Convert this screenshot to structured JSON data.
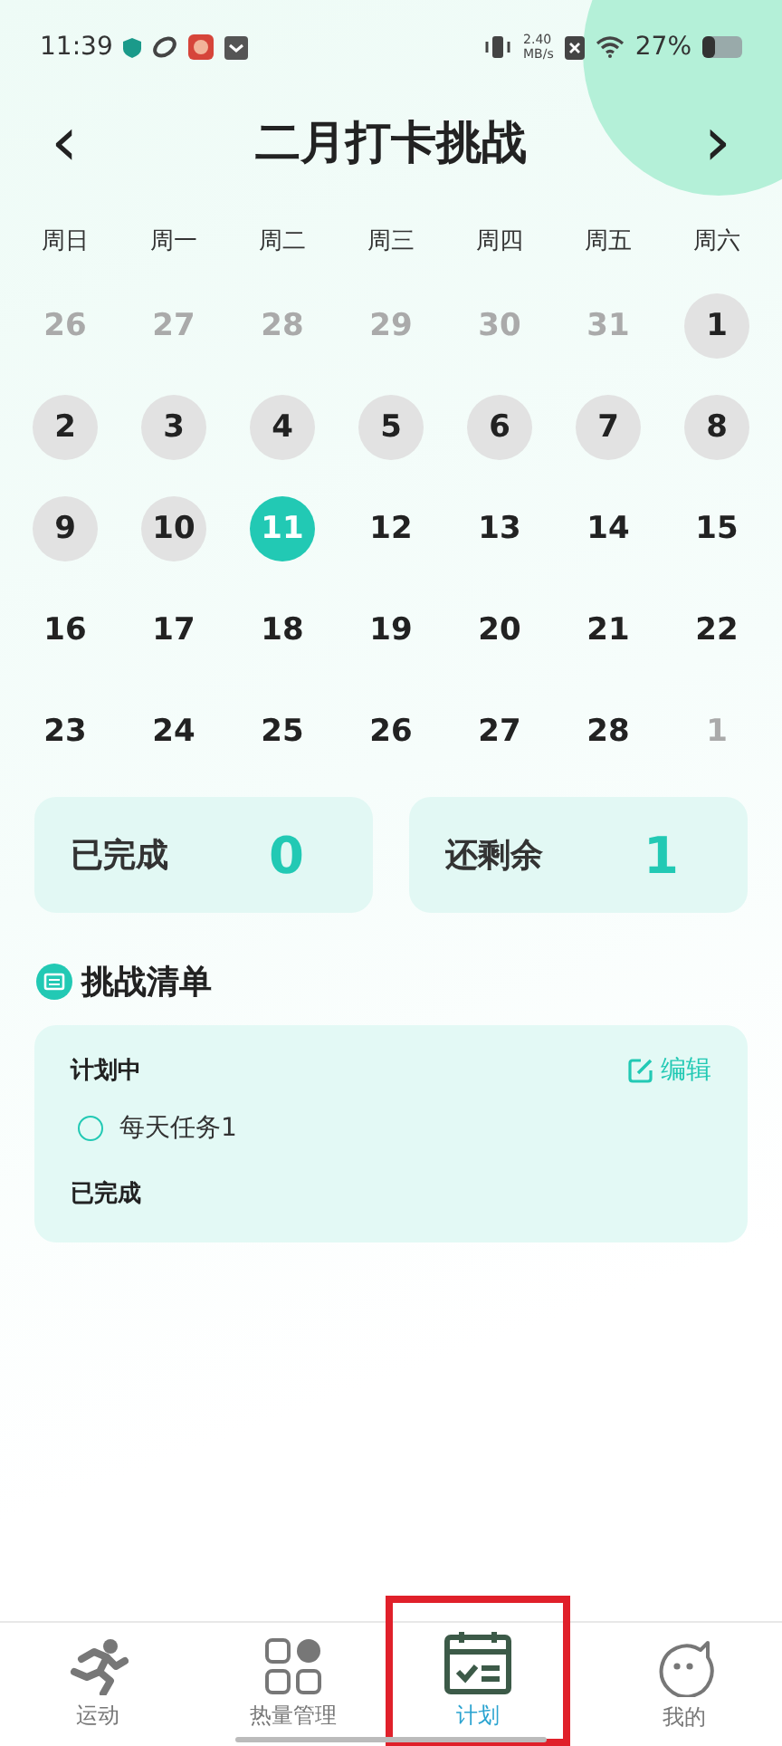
{
  "status_bar": {
    "time": "11:39",
    "speed": "2.40",
    "speed_unit": "MB/s",
    "battery": "27%"
  },
  "header": {
    "prev": "‹",
    "title": "二月打卡挑战",
    "next": "›"
  },
  "weekdays": [
    "周日",
    "周一",
    "周二",
    "周三",
    "周四",
    "周五",
    "周六"
  ],
  "days": [
    {
      "label": "26",
      "kind": "outside"
    },
    {
      "label": "27",
      "kind": "outside"
    },
    {
      "label": "28",
      "kind": "outside"
    },
    {
      "label": "29",
      "kind": "outside"
    },
    {
      "label": "30",
      "kind": "outside"
    },
    {
      "label": "31",
      "kind": "outside"
    },
    {
      "label": "1",
      "kind": "marked"
    },
    {
      "label": "2",
      "kind": "marked"
    },
    {
      "label": "3",
      "kind": "marked"
    },
    {
      "label": "4",
      "kind": "marked"
    },
    {
      "label": "5",
      "kind": "marked"
    },
    {
      "label": "6",
      "kind": "marked"
    },
    {
      "label": "7",
      "kind": "marked"
    },
    {
      "label": "8",
      "kind": "marked"
    },
    {
      "label": "9",
      "kind": "marked"
    },
    {
      "label": "10",
      "kind": "marked"
    },
    {
      "label": "11",
      "kind": "today"
    },
    {
      "label": "12",
      "kind": "normal"
    },
    {
      "label": "13",
      "kind": "normal"
    },
    {
      "label": "14",
      "kind": "normal"
    },
    {
      "label": "15",
      "kind": "normal"
    },
    {
      "label": "16",
      "kind": "normal"
    },
    {
      "label": "17",
      "kind": "normal"
    },
    {
      "label": "18",
      "kind": "normal"
    },
    {
      "label": "19",
      "kind": "normal"
    },
    {
      "label": "20",
      "kind": "normal"
    },
    {
      "label": "21",
      "kind": "normal"
    },
    {
      "label": "22",
      "kind": "normal"
    },
    {
      "label": "23",
      "kind": "normal"
    },
    {
      "label": "24",
      "kind": "normal"
    },
    {
      "label": "25",
      "kind": "normal"
    },
    {
      "label": "26",
      "kind": "normal"
    },
    {
      "label": "27",
      "kind": "normal"
    },
    {
      "label": "28",
      "kind": "normal"
    },
    {
      "label": "1",
      "kind": "outside"
    }
  ],
  "stats": [
    {
      "label": "已完成",
      "value": "0"
    },
    {
      "label": "还剩余",
      "value": "1"
    }
  ],
  "checklist": {
    "title": "挑战清单",
    "planned_title": "计划中",
    "edit": "编辑",
    "tasks": [
      {
        "label": "每天任务1",
        "done": false
      }
    ],
    "done_title": "已完成"
  },
  "tabs": [
    {
      "label": "运动",
      "kind": "run",
      "selected": false,
      "highlighted": false
    },
    {
      "label": "热量管理",
      "kind": "grid",
      "selected": false,
      "highlighted": false
    },
    {
      "label": "计划",
      "kind": "calendar",
      "selected": true,
      "highlighted": true
    },
    {
      "label": "我的",
      "kind": "face",
      "selected": false,
      "highlighted": false
    }
  ]
}
